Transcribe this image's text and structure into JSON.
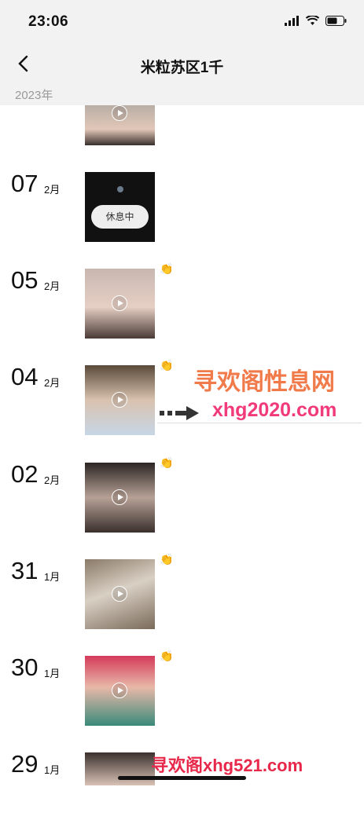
{
  "status": {
    "time": "23:06"
  },
  "nav": {
    "title": "米粒苏区1千"
  },
  "year_label": "2023年",
  "entries": [
    {
      "day": "07",
      "month": "2月",
      "thumb_text": "休息中"
    },
    {
      "day": "05",
      "month": "2月"
    },
    {
      "day": "04",
      "month": "2月"
    },
    {
      "day": "02",
      "month": "2月"
    },
    {
      "day": "31",
      "month": "1月"
    },
    {
      "day": "30",
      "month": "1月"
    },
    {
      "day": "29",
      "month": "1月"
    }
  ],
  "watermarks": {
    "top_text": "寻欢阁性息网",
    "top_url": "xhg2020.com",
    "bottom_text": "寻欢阁xhg521.com"
  },
  "colors": {
    "bar_bg": "#f2f2f2",
    "accent_like": "#d99417",
    "watermark_orange": "#f07a4a",
    "watermark_pink": "#f03a7a"
  }
}
